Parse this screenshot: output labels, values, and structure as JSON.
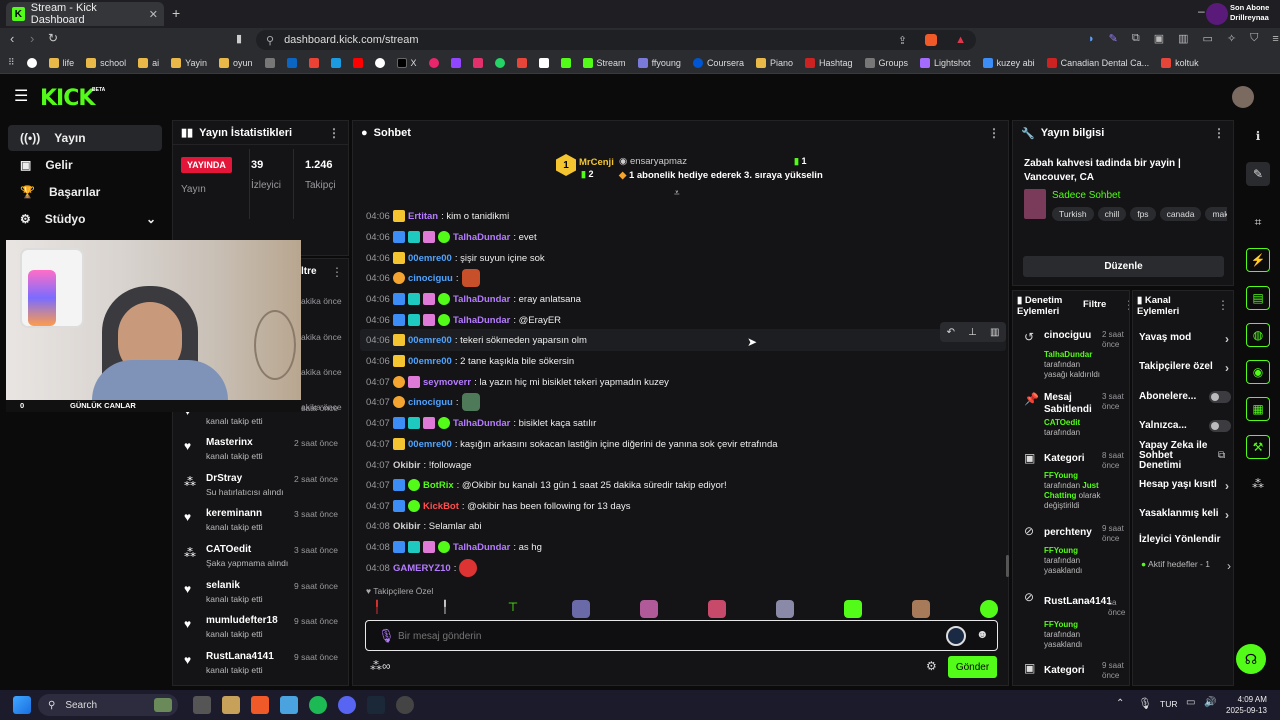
{
  "browser": {
    "tab_title": "Stream - Kick Dashboard",
    "new_tab": "+",
    "url": "dashboard.kick.com/stream",
    "bookmarks": [
      "life",
      "school",
      "ai",
      "Yayin",
      "oyun",
      "X",
      "Stream",
      "ffyoung",
      "Coursera",
      "Piano",
      "Hashtag",
      "Groups",
      "Lightshot",
      "kuzey abi",
      "Canadian Dental Ca...",
      "koltuk"
    ],
    "notification": {
      "line1": "Son Abone",
      "line2": "Drillreynaa"
    }
  },
  "kick": {
    "logo": "KICK",
    "beta": "BETA"
  },
  "nav": {
    "items": [
      {
        "label": "Yayın"
      },
      {
        "label": "Gelir"
      },
      {
        "label": "Başarılar"
      },
      {
        "label": "Stüdyo"
      }
    ]
  },
  "stats": {
    "title": "Yayın İstatistikleri",
    "live_badge": "YAYINDA",
    "live_label": "Yayın",
    "viewers_value": "39",
    "viewers_label": "İzleyici",
    "followers_value": "1.246",
    "followers_label": "Takipçi"
  },
  "webcam": {
    "left_label": "0",
    "center_label": "GÜNLÜK CANLAR"
  },
  "activity": {
    "filter_label": "ltre",
    "rows": [
      {
        "name": "turgutkizgir",
        "sub": "kanalı takip etti",
        "time": "1 saat önce"
      },
      {
        "name": "Masterinx",
        "sub": "kanalı takip etti",
        "time": "2 saat önce"
      },
      {
        "name": "DrStray",
        "sub": "Su hatırlatıcısı alındı",
        "time": "2 saat önce"
      },
      {
        "name": "kereminann",
        "sub": "kanalı takip etti",
        "time": "3 saat önce"
      },
      {
        "name": "CATOedit",
        "sub": "Şaka yapmama alındı",
        "time": "3 saat önce"
      },
      {
        "name": "selanik",
        "sub": "kanalı takip etti",
        "time": "9 saat önce"
      },
      {
        "name": "mumludefter18",
        "sub": "kanalı takip etti",
        "time": "9 saat önce"
      },
      {
        "name": "RustLana4141",
        "sub": "kanalı takip etti",
        "time": "9 saat önce"
      }
    ],
    "hidden_times": [
      "akika önce",
      "akika önce",
      "akika önce",
      "akika önce"
    ]
  },
  "chat": {
    "title": "Sohbet",
    "pinned": {
      "rank": "1",
      "top_user": "MrCenji",
      "top_count": "2",
      "user": "ensaryapmaz",
      "count": "1",
      "message": "1 abonelik hediye ederek 3. sıraya yükselin"
    },
    "messages": [
      {
        "time": "04:06",
        "user": "Ertitan",
        "text": ": kim o tanidikmi",
        "color": "#b57cff"
      },
      {
        "time": "04:06",
        "user": "TalhaDundar",
        "text": ": evet",
        "color": "#b57cff"
      },
      {
        "time": "04:06",
        "user": "00emre00",
        "text": ": şişir suyun içine sok",
        "color": "#4fa3ff"
      },
      {
        "time": "04:06",
        "user": "cinociguu",
        "text": ":",
        "color": "#4fa3ff"
      },
      {
        "time": "04:06",
        "user": "TalhaDundar",
        "text": ": eray anlatsana",
        "color": "#b57cff"
      },
      {
        "time": "04:06",
        "user": "TalhaDundar",
        "text": ": @ErayER",
        "color": "#b57cff"
      },
      {
        "time": "04:06",
        "user": "00emre00",
        "text": ": tekeri sökmeden yaparsın olm",
        "color": "#4fa3ff"
      },
      {
        "time": "04:06",
        "user": "00emre00",
        "text": ": 2 tane kaşıkla bile sökersin",
        "color": "#4fa3ff"
      },
      {
        "time": "04:07",
        "user": "seymoverr",
        "text": ": la yazın hiç mi bisiklet tekeri yapmadın kuzey",
        "color": "#b57cff"
      },
      {
        "time": "04:07",
        "user": "cinociguu",
        "text": ":",
        "color": "#4fa3ff"
      },
      {
        "time": "04:07",
        "user": "TalhaDundar",
        "text": ": bisiklet kaça satılır",
        "color": "#b57cff"
      },
      {
        "time": "04:07",
        "user": "00emre00",
        "text": ": kaşığın arkasını sokacan lastiğin içine diğerini de yanına sok çevir etrafında",
        "color": "#4fa3ff"
      },
      {
        "time": "04:07",
        "user": "Okibir",
        "text": ": !followage",
        "color": "#cfcfcf"
      },
      {
        "time": "04:07",
        "user": "BotRix",
        "text": ": @Okibir bu kanalı 13 gün 1 saat 25 dakika süredir takip ediyor!",
        "color": "#53fc18"
      },
      {
        "time": "04:07",
        "user": "KickBot",
        "text": ": @okibir has been following for 13 days",
        "color": "#ff4f4f"
      },
      {
        "time": "04:08",
        "user": "Okibir",
        "text": ": Selamlar abi",
        "color": "#cfcfcf"
      },
      {
        "time": "04:08",
        "user": "TalhaDundar",
        "text": ": as hg",
        "color": "#b57cff"
      },
      {
        "time": "04:08",
        "user": "GAMERYZ10",
        "text": ":",
        "color": "#b57cff"
      }
    ],
    "followers_only": "Takipçilere Özel",
    "placeholder": "Bir mesaj gönderin",
    "send": "Gönder"
  },
  "stream_info": {
    "title": "Yayın bilgisi",
    "stream_title": "Zabah kahvesi tadinda bir yayin | Vancouver, CA",
    "category": "Sadece Sohbet",
    "tags": [
      "Turkish",
      "chill",
      "fps",
      "canada",
      "maka"
    ],
    "edit": "Düzenle"
  },
  "moderation": {
    "title": "Denetim Eylemleri",
    "filter": "Filtre",
    "rows": [
      {
        "title": "cinociguu",
        "time": "2 saat önce",
        "actor": "TalhaDundar",
        "desc": "tarafından yasağı kaldırıldı"
      },
      {
        "title": "Mesaj Sabitlendi",
        "time": "3 saat önce",
        "actor": "CATOedit",
        "desc": "tarafından"
      },
      {
        "title": "Kategori",
        "time": "8 saat önce",
        "actor": "FFYoung",
        "desc": "tarafından",
        "extra": "Just Chatting",
        "extra2": "olarak değiştirildi"
      },
      {
        "title": "perchteny",
        "time": "9 saat önce",
        "actor": "FFYoung",
        "desc": "tarafından yasaklandı"
      },
      {
        "title": "RustLana4141",
        "time": "sa önce",
        "actor": "FFYoung",
        "desc": "tarafından yasaklandı"
      },
      {
        "title": "Kategori",
        "time": "9 saat önce",
        "actor": "",
        "desc": ""
      }
    ]
  },
  "channel_controls": {
    "title": "Kanal Eylemleri",
    "items": [
      "Yavaş mod",
      "Takipçilere özel",
      "Abonelere...",
      "Yalnızca...",
      "Yapay Zeka ile Sohbet Denetimi",
      "Hesap yaşı kısıtl",
      "Yasaklanmış keli",
      "İzleyici Yönlendir"
    ],
    "active_targets": "Aktif hedefler - 1"
  },
  "taskbar": {
    "search": "Search",
    "lang": "TUR",
    "time": "4:09 AM",
    "date": "2025-09-13"
  }
}
